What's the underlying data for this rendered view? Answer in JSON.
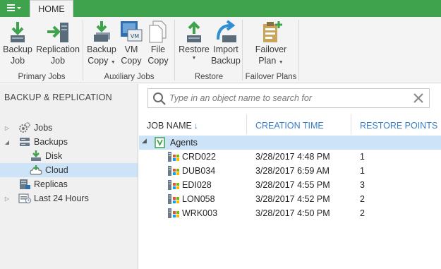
{
  "tabs": {
    "home": "HOME"
  },
  "ribbon": {
    "groups": [
      {
        "label": "Primary Jobs",
        "buttons": [
          {
            "label1": "Backup",
            "label2": "Job",
            "icon": "backup-job-icon"
          },
          {
            "label1": "Replication",
            "label2": "Job",
            "icon": "replication-job-icon"
          }
        ]
      },
      {
        "label": "Auxiliary Jobs",
        "buttons": [
          {
            "label1": "Backup",
            "label2": "Copy",
            "icon": "backup-copy-icon",
            "dropdown": true
          },
          {
            "label1": "VM",
            "label2": "Copy",
            "icon": "vm-copy-icon",
            "badge": "VM"
          },
          {
            "label1": "File",
            "label2": "Copy",
            "icon": "file-copy-icon"
          }
        ]
      },
      {
        "label": "Restore",
        "buttons": [
          {
            "label1": "Restore",
            "label2": "",
            "icon": "restore-icon",
            "dropdown": true
          },
          {
            "label1": "Import",
            "label2": "Backup",
            "icon": "import-backup-icon"
          }
        ]
      },
      {
        "label": "Failover Plans",
        "buttons": [
          {
            "label1": "Failover",
            "label2": "Plan",
            "icon": "failover-plan-icon",
            "dropdown": true
          }
        ]
      }
    ]
  },
  "nav": {
    "title": "BACKUP & REPLICATION",
    "items": [
      {
        "label": "Jobs"
      },
      {
        "label": "Backups"
      },
      {
        "label": "Disk"
      },
      {
        "label": "Cloud"
      },
      {
        "label": "Replicas"
      },
      {
        "label": "Last 24 Hours"
      }
    ]
  },
  "search": {
    "placeholder": "Type in an object name to search for",
    "value": ""
  },
  "grid": {
    "columns": [
      "JOB NAME",
      "CREATION TIME",
      "RESTORE POINTS"
    ],
    "group": "Agents",
    "rows": [
      {
        "name": "CRD022",
        "time": "3/28/2017 4:48 PM",
        "points": "1"
      },
      {
        "name": "DUB034",
        "time": "3/28/2017 6:59 AM",
        "points": "1"
      },
      {
        "name": "EDI028",
        "time": "3/28/2017 4:55 PM",
        "points": "3"
      },
      {
        "name": "LON058",
        "time": "3/28/2017 4:52 PM",
        "points": "2"
      },
      {
        "name": "WRK003",
        "time": "3/28/2017 4:50 PM",
        "points": "2"
      }
    ]
  },
  "colors": {
    "brand_green": "#3fa34d",
    "selection": "#cde3f7",
    "link_blue": "#3a7ec7"
  }
}
